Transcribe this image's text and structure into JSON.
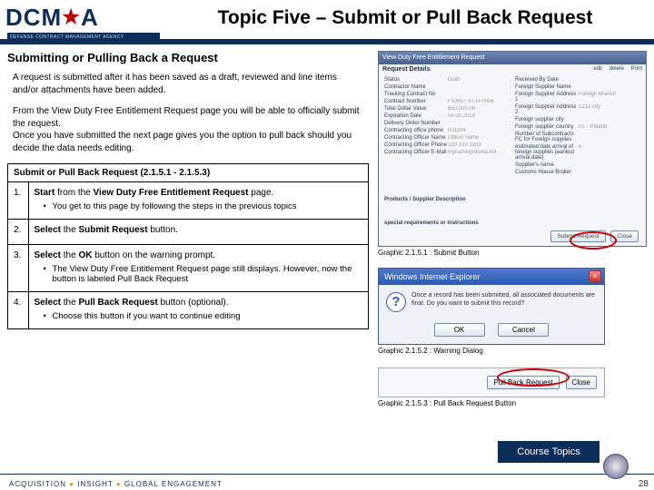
{
  "header": {
    "logo_acronym_pre": "DCM",
    "logo_acronym_post": "A",
    "logo_subline": "DEFENSE CONTRACT MANAGEMENT AGENCY",
    "title": "Topic Five – Submit or Pull Back Request"
  },
  "left": {
    "subhead": "Submitting or Pulling Back a Request",
    "intro1": "A request is submitted after it has been saved as a draft, reviewed and line items and/or attachments have been added.",
    "intro2": "From the View Duty Free Entitlement Request page you will be able to officially submit the request.\nOnce you have submitted the next page gives you the option to pull back should you decide the data needs editing.",
    "table_caption": "Submit or Pull Back Request (2.1.5.1 - 2.1.5.3)",
    "steps": [
      {
        "num": "1.",
        "main_pre": "Start",
        "main_mid": " from the ",
        "main_b2": "View Duty Free Entitlement Request",
        "main_post": " page.",
        "bullets": [
          "You get to this page by following the steps in the previous topics"
        ]
      },
      {
        "num": "2.",
        "main_pre": "Select",
        "main_mid": " the ",
        "main_b2": "Submit Request",
        "main_post": " button.",
        "bullets": []
      },
      {
        "num": "3.",
        "main_pre": "Select",
        "main_mid": " the ",
        "main_b2": "OK",
        "main_post": " button on the warning prompt.",
        "bullets": [
          "The View Duty Free Entitlement Request page still displays.  However, now the button is labeled Pull Back Request"
        ]
      },
      {
        "num": "4.",
        "main_pre": "Select",
        "main_mid": " the ",
        "main_b2": "Pull Back Request",
        "main_post": " button (optional).",
        "bullets": [
          "Choose this button if you want to continue editing"
        ]
      }
    ]
  },
  "right": {
    "win1": {
      "title": "View Duty Free Entitlement Request",
      "section": "Request Details",
      "tool_edit": "edit",
      "tool_delete": "delete",
      "tool_print": "Print",
      "left_fields": [
        {
          "label": "Status",
          "value": "Draft"
        },
        {
          "label": "Contractor Name",
          "value": ""
        },
        {
          "label": "Tracking Contract No",
          "value": ""
        },
        {
          "label": "Contract Number",
          "value": "F33657-97-D-0006"
        },
        {
          "label": "Total Dollar Value",
          "value": "$50,000.00"
        },
        {
          "label": "Expiration Date",
          "value": "04.02.2010"
        },
        {
          "label": "Delivery Order Number",
          "value": ""
        },
        {
          "label": "Contracting office phone",
          "value": "001104"
        },
        {
          "label": "Contracting Officer Name",
          "value": "Officer name"
        },
        {
          "label": "Contracting Officer Phone",
          "value": "333 333 3333"
        },
        {
          "label": "Contracting Officer E-Mail",
          "value": "myname@dcma.mil"
        }
      ],
      "right_fields": [
        {
          "label": "Received By Date",
          "value": ""
        },
        {
          "label": "Foreign Supplier Name",
          "value": ""
        },
        {
          "label": "Foreign Supplier Address 1",
          "value": "Foreign Branch"
        },
        {
          "label": "Foreign Supplier Address 2",
          "value": "1212 city"
        },
        {
          "label": "Foreign supplier city",
          "value": ""
        },
        {
          "label": "Foreign supplier country",
          "value": "PL - Poland"
        },
        {
          "label": "Number of Subcontracts FC for Foreign supplies",
          "value": ""
        },
        {
          "label": "estimated date arrival of foreign supplies (earliest arrival date)",
          "value": "5"
        },
        {
          "label": "Supplier's name",
          "value": ""
        },
        {
          "label": "Customs House Broker",
          "value": ""
        }
      ],
      "subhead2": "Products / Supplier Description",
      "subhead3": "special requirements or instructions",
      "btn_submit": "Submit Request",
      "btn_close": "Close"
    },
    "cap1": "Graphic  2.1.5.1 : Submit Button",
    "dlg": {
      "title": "Windows Internet Explorer",
      "msg": "Once a record has been submitted, all associated documents are final. Do you want to submit this record?",
      "ok": "OK",
      "cancel": "Cancel"
    },
    "cap2": "Graphic  2.1.5.2 : Warning Dialog",
    "pb": {
      "btn_pull": "Pull Back Request",
      "btn_close": "Close"
    },
    "cap3": "Graphic  2.1.5.3 : Pull Back Request Button"
  },
  "course_topics": "Course Topics",
  "footer": {
    "tag_a": "ACQUISITION",
    "tag_b": "INSIGHT",
    "tag_c": "GLOBAL ENGAGEMENT",
    "page": "28"
  }
}
